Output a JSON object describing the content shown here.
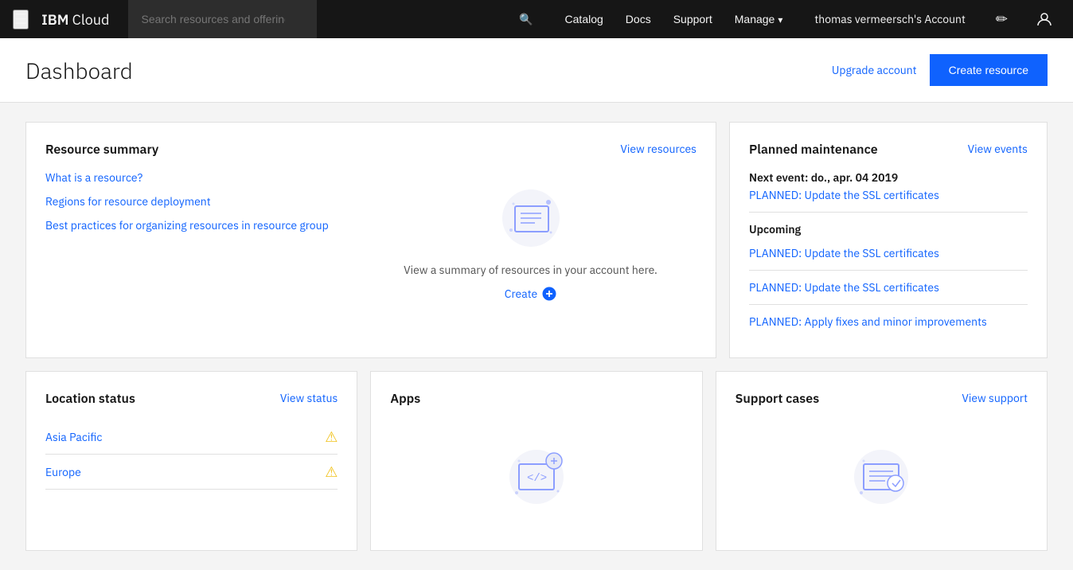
{
  "topnav": {
    "brand_light": "IBM ",
    "brand_bold": "Cloud",
    "search_placeholder": "Search resources and offerings...",
    "links": [
      {
        "label": "Catalog"
      },
      {
        "label": "Docs"
      },
      {
        "label": "Support"
      },
      {
        "label": "Manage",
        "has_dropdown": true
      }
    ],
    "account": "thomas vermeersch's Account",
    "icons": {
      "edit": "✎",
      "user": "👤",
      "menu": "≡",
      "search": "🔍"
    }
  },
  "header": {
    "title": "Dashboard",
    "upgrade_label": "Upgrade account",
    "create_resource_label": "Create resource"
  },
  "resource_summary": {
    "title": "Resource summary",
    "view_link": "View resources",
    "links": [
      "What is a resource?",
      "Regions for resource deployment",
      "Best practices for organizing resources in resource group"
    ],
    "empty_text": "View a summary of resources in your account here.",
    "create_label": "Create"
  },
  "planned_maintenance": {
    "title": "Planned maintenance",
    "view_link": "View events",
    "next_event_label": "Next event: do., apr. 04 2019",
    "next_event_detail": "PLANNED: Update the SSL certificates",
    "upcoming_title": "Upcoming",
    "upcoming_items": [
      "PLANNED: Update the SSL certificates",
      "PLANNED: Update the SSL certificates",
      "PLANNED: Apply fixes and minor improvements"
    ]
  },
  "location_status": {
    "title": "Location status",
    "view_link": "View status",
    "locations": [
      {
        "name": "Asia Pacific",
        "warning": true
      },
      {
        "name": "Europe",
        "warning": true
      }
    ]
  },
  "apps": {
    "title": "Apps"
  },
  "support_cases": {
    "title": "Support cases",
    "view_link": "View support"
  }
}
